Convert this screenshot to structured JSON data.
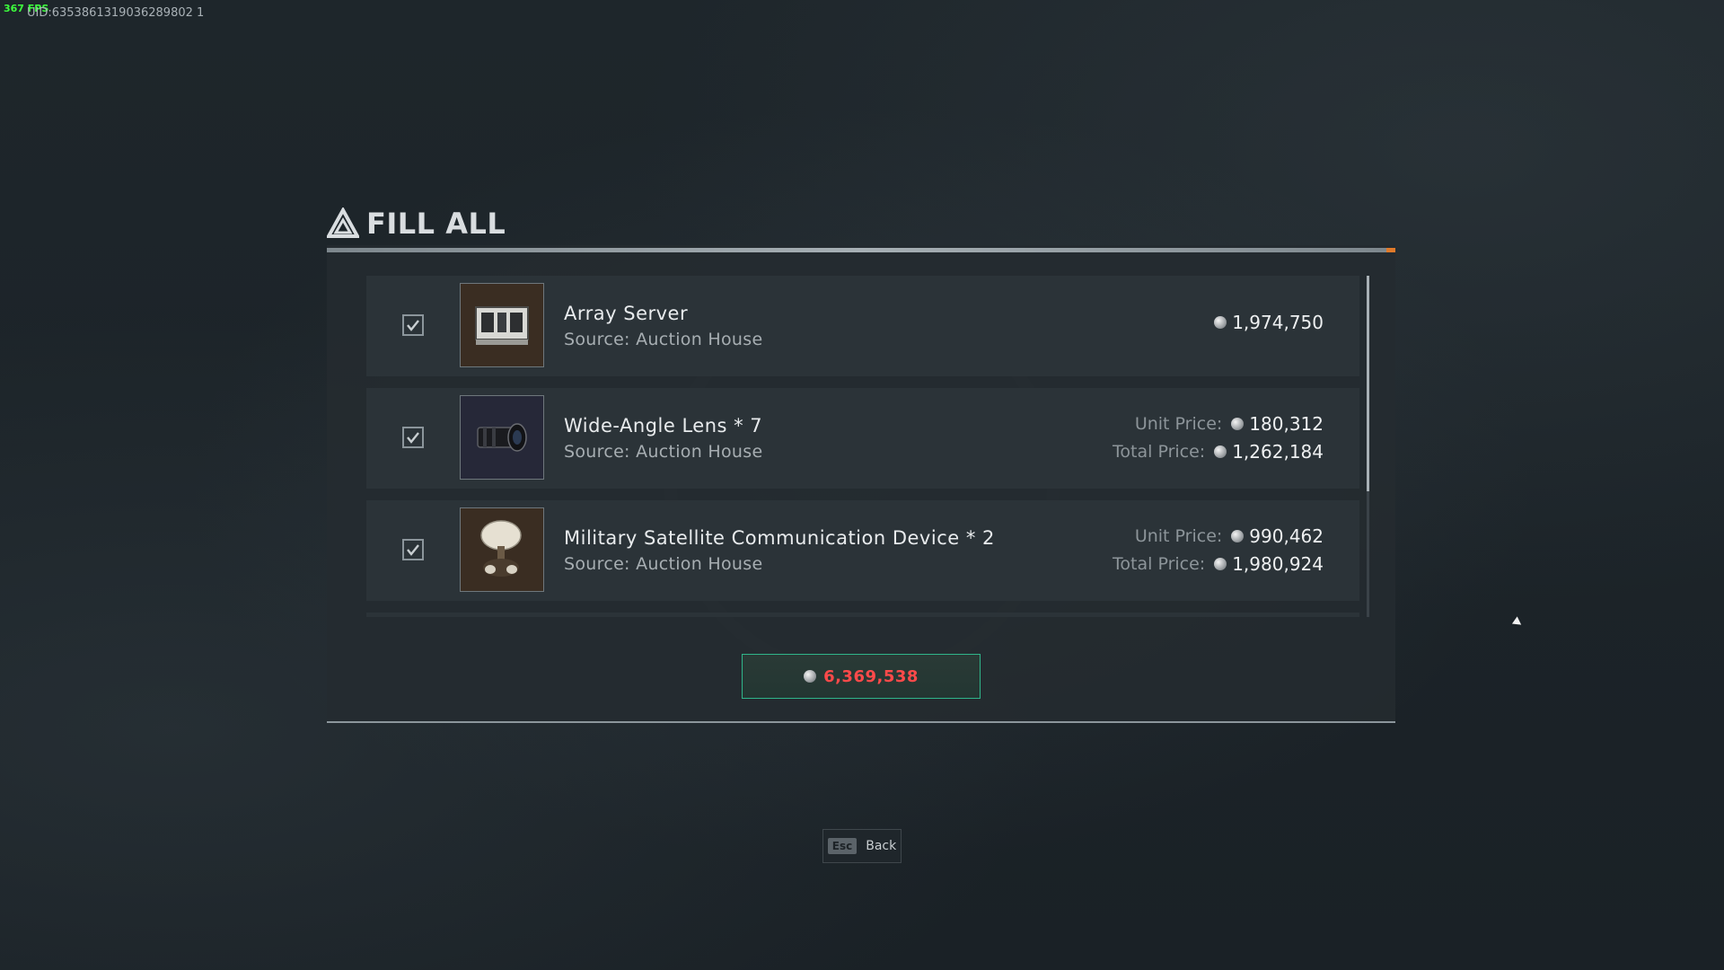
{
  "overlay": {
    "fps": "367 FPS",
    "uid": "UID:6353861319036289802 1"
  },
  "modal": {
    "title": "FILL ALL",
    "items": [
      {
        "name": "Array Server",
        "source": "Source: Auction House",
        "checked": true,
        "icon": "server-icon",
        "price": "1,974,750"
      },
      {
        "name": "Wide-Angle Lens * 7",
        "source": "Source: Auction House",
        "checked": true,
        "icon": "lens-icon",
        "unit_label": "Unit Price:",
        "unit_price": "180,312",
        "total_label": "Total Price:",
        "total_price": "1,262,184"
      },
      {
        "name": "Military Satellite Communication Device * 2",
        "source": "Source: Auction House",
        "checked": true,
        "icon": "satellite-dish-icon",
        "unit_label": "Unit Price:",
        "unit_price": "990,462",
        "total_label": "Total Price:",
        "total_price": "1,980,924"
      }
    ],
    "total": "6,369,538"
  },
  "footer": {
    "back_key": "Esc",
    "back_label": "Back"
  },
  "colors": {
    "accent_green": "#2fb58a",
    "total_red": "#ff4a4a",
    "background": "#1c2328"
  }
}
